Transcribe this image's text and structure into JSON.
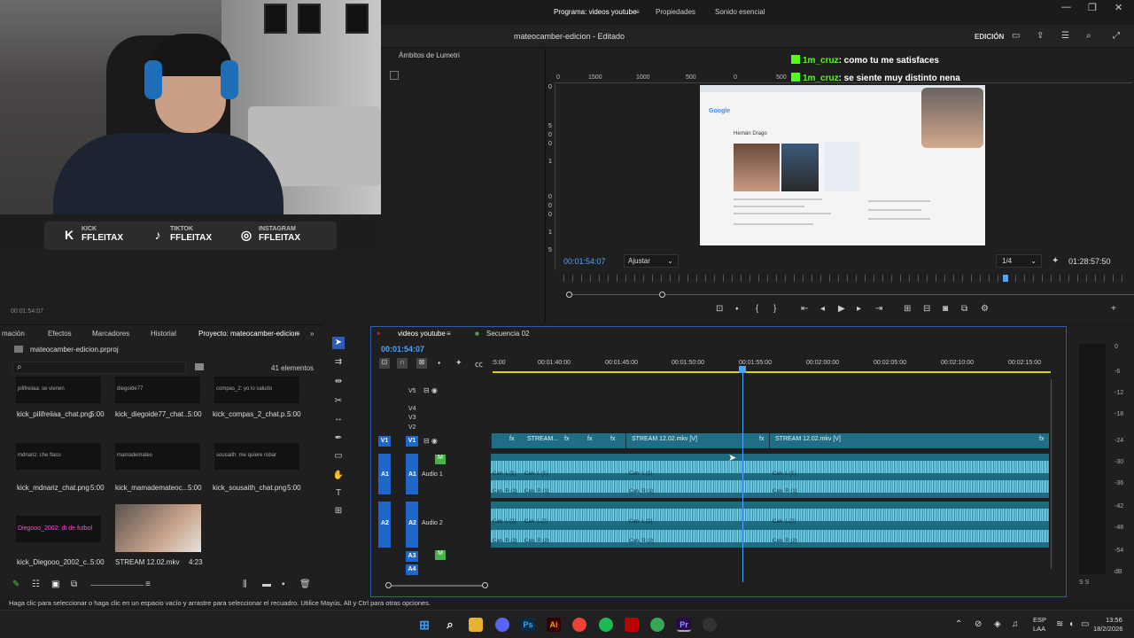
{
  "window": {
    "minimize": "—",
    "maximize": "❐",
    "close": "✕"
  },
  "app": {
    "title": "mateocamber-edicion - Editado",
    "workspace": "EDICIÓN"
  },
  "socials": [
    {
      "icon": "K",
      "network": "KICK",
      "handle": "FFLEITAX"
    },
    {
      "icon": "♪",
      "network": "TIKTOK",
      "handle": "FFLEITAX"
    },
    {
      "icon": "◎",
      "network": "INSTAGRAM",
      "handle": "FFLEITAX"
    }
  ],
  "lumetri": {
    "tab": "Ámbitos de Lumetri"
  },
  "source_timecode": "00:01:54:07",
  "program": {
    "tabs": [
      "Programa: videos youtube",
      "Propiedades",
      "Sonido esencial"
    ],
    "menu_icon": "≡",
    "current_time": "00:01:54:07",
    "fit": "Ajustar",
    "resolution": "1/4",
    "duration": "01:28:57:50",
    "ruler": [
      "0",
      "1500",
      "1000",
      "500",
      "0",
      "500",
      "1000",
      "1500"
    ],
    "vruler": [
      "0",
      "5",
      "0",
      "0",
      "1",
      "0",
      "0",
      "0",
      "1",
      "5",
      "0",
      "0"
    ],
    "video_brand": "Google",
    "video_name": "Hernán Drago"
  },
  "chat": [
    {
      "user": "1m_cruz",
      "msg": ": como tu me satisfaces"
    },
    {
      "user": "1m_cruz",
      "msg": ": se siente muy distinto nena"
    }
  ],
  "project": {
    "tabs": [
      "mación",
      "Efectos",
      "Marcadores",
      "Historial",
      "Proyecto: mateocamber-edicion"
    ],
    "file": "mateocamber-edicion.prproj",
    "count": "41 elementos",
    "items": [
      {
        "name": "kick_pilifreiiaa_chat.png",
        "dur": "5:00",
        "thumb": "pilifreiiaa: se vienen"
      },
      {
        "name": "kick_diegoide77_chat...",
        "dur": "5:00",
        "thumb": "diegoide77"
      },
      {
        "name": "kick_compas_2_chat.p...",
        "dur": "5:00",
        "thumb": "compas_2: yo lo saludo"
      },
      {
        "name": "kick_mdnariz_chat.png",
        "dur": "5:00",
        "thumb": "mdnariz: che flaco"
      },
      {
        "name": "kick_mamademateoc...",
        "dur": "5:00",
        "thumb": "mamademateo"
      },
      {
        "name": "kick_sousaith_chat.png",
        "dur": "5:00",
        "thumb": "sousaith: me quiere robar"
      },
      {
        "name": "kick_Diegooo_2002_c...",
        "dur": "5:00",
        "thumb": "Diegooo_2002: dt de futbol"
      },
      {
        "name": "STREAM 12.02.mkv",
        "dur": "4:23",
        "thumb": ""
      }
    ]
  },
  "timeline": {
    "tabs": [
      "videos youtube",
      "Secuencia 02"
    ],
    "time": "00:01:54:07",
    "ruler": [
      ":5:00",
      "00:01:40:00",
      "00:01:45:00",
      "00:01:50:00",
      "00:01:55:00",
      "00:02:00:00",
      "00:02:05:00",
      "00:02:10:00",
      "00:02:15:00"
    ],
    "tracks": {
      "v5": "V5",
      "v4": "V4",
      "v3": "V3",
      "v2": "V2",
      "v1": "V1",
      "a1": "A1",
      "a2": "A2",
      "a3": "A3",
      "a4": "A4",
      "audio1": "Audio 1",
      "audio2": "Audio 2"
    },
    "clips": [
      "STREAM...",
      "STREAM 12.02.mkv [V]",
      "STREAM 12.02.mkv [V]"
    ],
    "fx": "fx",
    "chL": "Can. L (1)",
    "chR": "Can. R (1)",
    "chL2": "Can. L (2)",
    "chR2": "Can. R (2)"
  },
  "meter": [
    "0",
    "-6",
    "-12",
    "-18",
    "-24",
    "-30",
    "-36",
    "-42",
    "-48",
    "-54",
    "dB"
  ],
  "meter_bottom": "S  S",
  "status": "Haga clic para seleccionar o haga clic en un espacio vacío y arrastre para seleccionar el recuadro. Utilice Mayús, Alt y Ctrl para otras opciones.",
  "tray": {
    "lang": "ESP",
    "kb": "LAA",
    "time": "13:56",
    "date": "18/2/2026"
  },
  "colors": {
    "accent": "#4da3ff",
    "kick": "#53fc18",
    "clip": "#1f6e86",
    "track_tag": "#1f66c9"
  }
}
